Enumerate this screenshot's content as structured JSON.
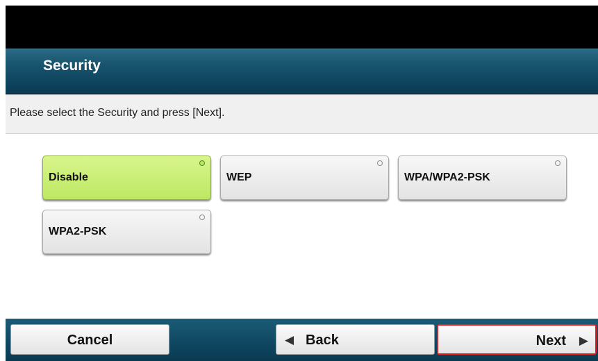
{
  "header": {
    "title": "Security"
  },
  "instruction": "Please select the Security and press [Next].",
  "options": [
    {
      "label": "Disable",
      "selected": true
    },
    {
      "label": "WEP",
      "selected": false
    },
    {
      "label": "WPA/WPA2-PSK",
      "selected": false
    },
    {
      "label": "WPA2-PSK",
      "selected": false
    }
  ],
  "footer": {
    "cancel_label": "Cancel",
    "back_label": "Back",
    "back_icon": "left-triangle-icon",
    "next_label": "Next",
    "next_icon": "right-triangle-icon"
  },
  "colors": {
    "selected_option": "#bde863",
    "title_bar": "#0f4660",
    "highlight_border": "#e02020"
  }
}
